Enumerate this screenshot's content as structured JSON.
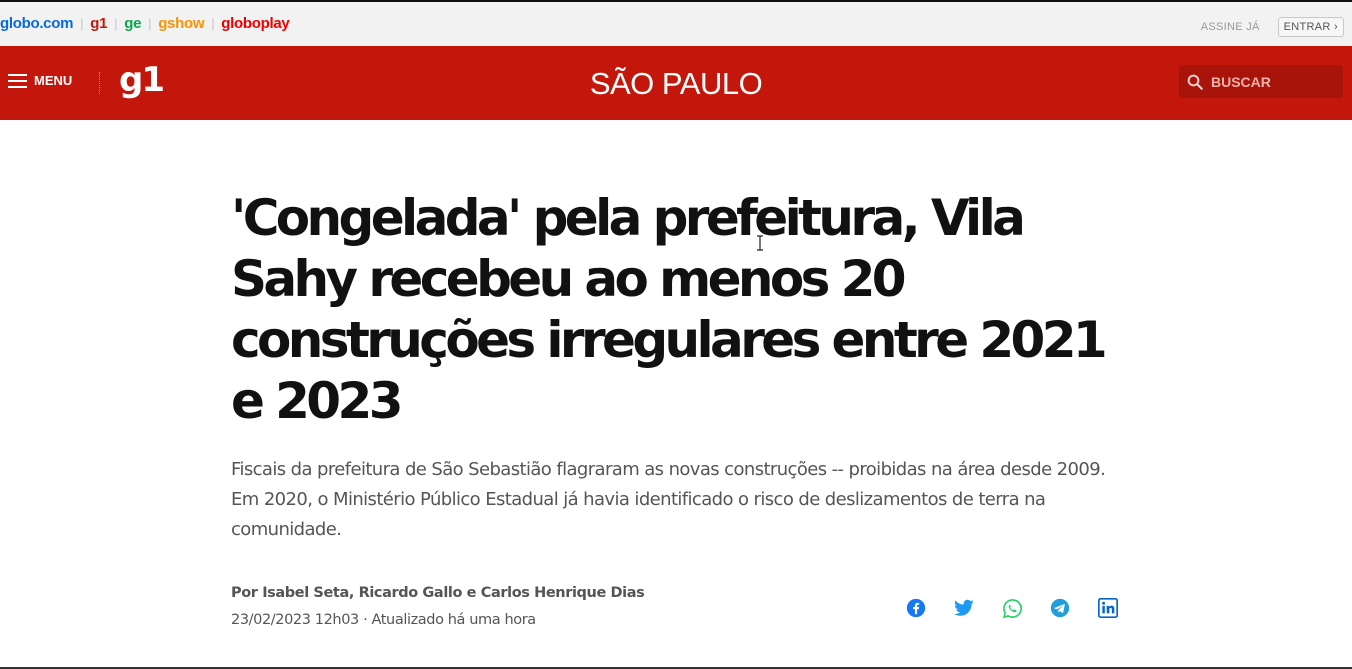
{
  "globo_bar": {
    "links": [
      {
        "label": "globo.com",
        "color": "#0669de"
      },
      {
        "label": "g1",
        "color": "#c4170c"
      },
      {
        "label": "ge",
        "color": "#06aa48"
      },
      {
        "label": "gshow",
        "color": "#fa9400"
      },
      {
        "label": "globoplay",
        "color": "#ee0000"
      }
    ],
    "subscribe_label": "ASSINE JÁ",
    "login_label": "ENTRAR ›"
  },
  "header": {
    "menu_label": "MENU",
    "logo_text": "g1",
    "section_title": "SÃO PAULO",
    "search_placeholder": "BUSCAR",
    "brand_color": "#c4170c"
  },
  "article": {
    "headline": "'Congelada' pela prefeitura, Vila Sahy recebeu ao menos 20 construções irregulares entre 2021 e 2023",
    "subtitle": "Fiscais da prefeitura de São Sebastião flagraram as novas construções -- proibidas na área desde 2009. Em 2020, o Ministério Público Estadual já havia identificado o risco de deslizamentos de terra na comunidade.",
    "byline": "Por Isabel Seta, Ricardo Gallo e Carlos Henrique Dias",
    "dateline": "23/02/2023 12h03 · Atualizado há uma hora"
  },
  "share": [
    {
      "icon": "facebook-icon",
      "color": "#1877f2"
    },
    {
      "icon": "twitter-icon",
      "color": "#1d9bf0"
    },
    {
      "icon": "whatsapp-icon",
      "color": "#25d366"
    },
    {
      "icon": "telegram-icon",
      "color": "#229ed9"
    },
    {
      "icon": "linkedin-icon",
      "color": "#0a66c2"
    }
  ]
}
